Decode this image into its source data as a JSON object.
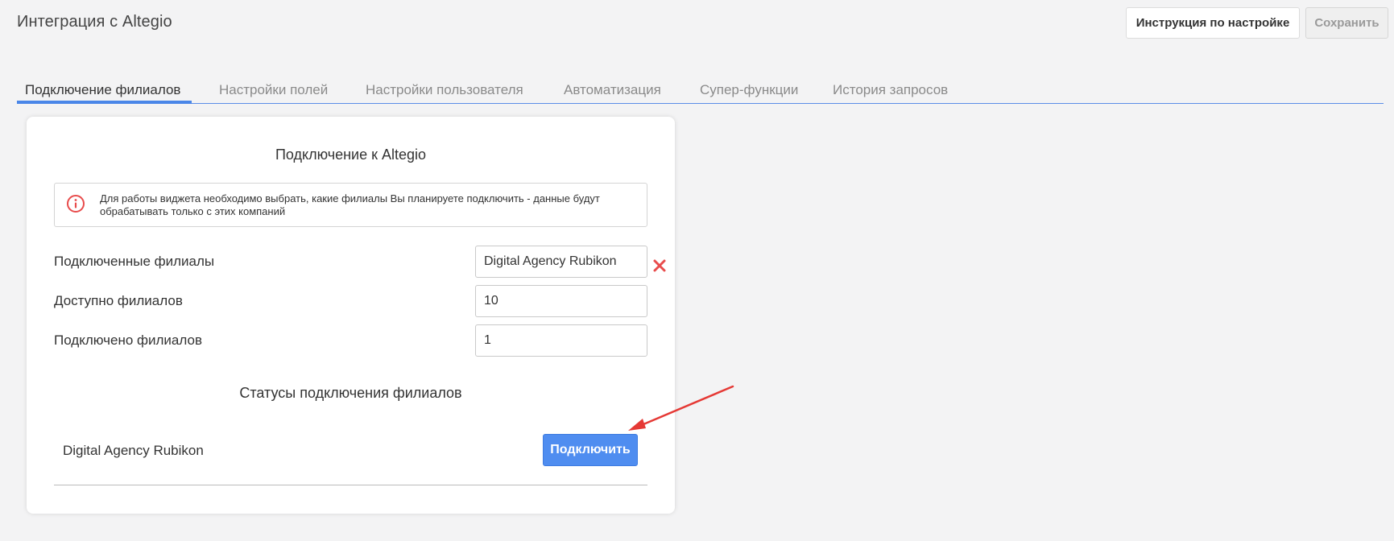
{
  "header": {
    "title": "Интеграция с Altegio",
    "help_label": "Инструкция по настройке",
    "save_label": "Сохранить"
  },
  "tabs": [
    {
      "label": "Подключение филиалов",
      "active": true
    },
    {
      "label": "Настройки полей",
      "active": false
    },
    {
      "label": "Настройки пользователя",
      "active": false
    },
    {
      "label": "Автоматизация",
      "active": false
    },
    {
      "label": "Супер-функции",
      "active": false
    },
    {
      "label": "История запросов",
      "active": false
    }
  ],
  "card": {
    "title": "Подключение к Altegio",
    "info_icon": "info-circle-icon",
    "info_text": "Для работы виджета необходимо выбрать, какие филиалы Вы планируете подключить - данные будут обрабатывать только с этих компаний",
    "fields": {
      "connected_branches_label": "Подключенные филиалы",
      "connected_branches_value": "Digital Agency Rubikon",
      "available_label": "Доступно филиалов",
      "available_value": "10",
      "connected_count_label": "Подключено филиалов",
      "connected_count_value": "1"
    },
    "statuses_title": "Статусы подключения филиалов",
    "branches": [
      {
        "name": "Digital Agency Rubikon",
        "button_label": "Подключить"
      }
    ]
  },
  "colors": {
    "accent": "#4a86e8",
    "button_primary": "#4f8df0",
    "danger": "#e84c4c"
  }
}
